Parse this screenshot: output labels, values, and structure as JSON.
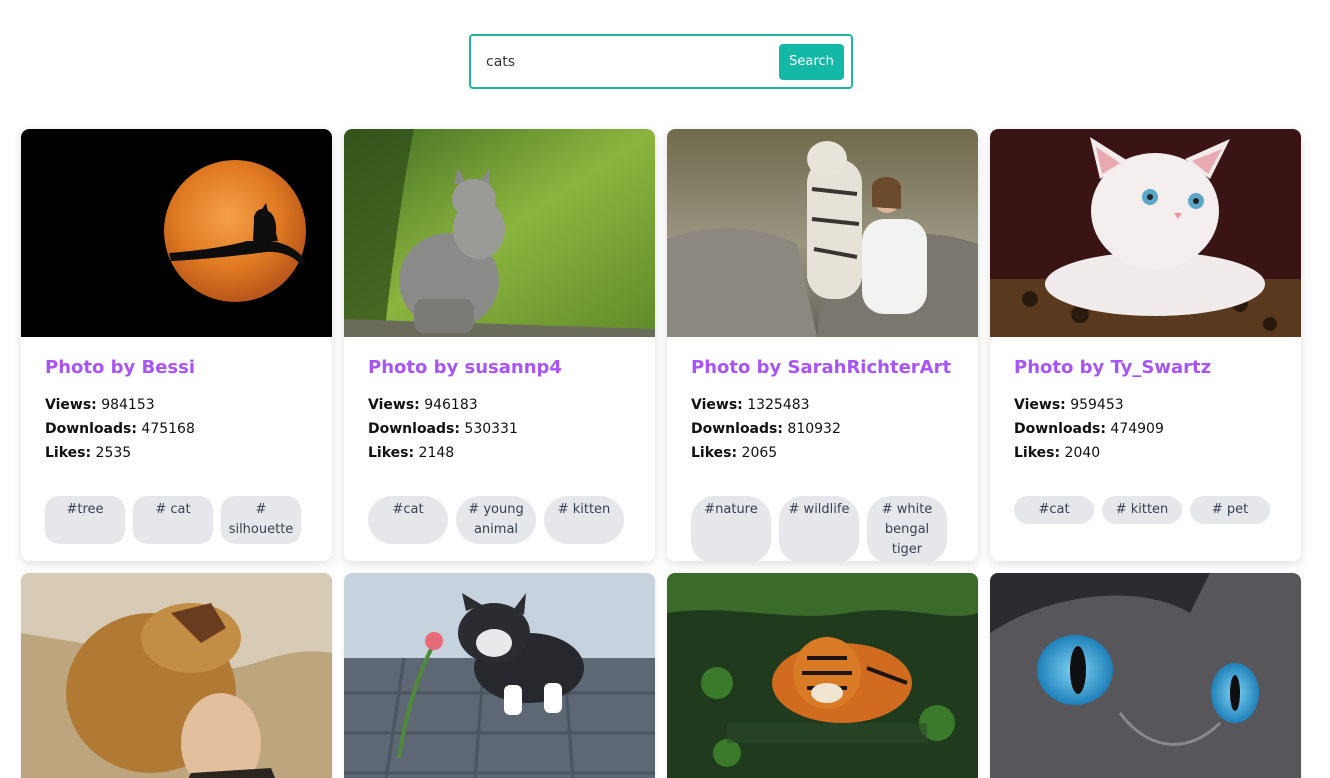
{
  "search": {
    "value": "cats",
    "button_label": "Search"
  },
  "cards": [
    {
      "title": "Photo by Bessi",
      "views_label": "Views:",
      "views": "984153",
      "downloads_label": "Downloads:",
      "downloads": "475168",
      "likes_label": "Likes:",
      "likes": "2535",
      "tags": [
        "#tree",
        "# cat",
        "# silhouette"
      ]
    },
    {
      "title": "Photo by susannp4",
      "views_label": "Views:",
      "views": "946183",
      "downloads_label": "Downloads:",
      "downloads": "530331",
      "likes_label": "Likes:",
      "likes": "2148",
      "tags": [
        "#cat",
        "# young animal",
        "# kitten"
      ]
    },
    {
      "title": "Photo by SarahRichterArt",
      "views_label": "Views:",
      "views": "1325483",
      "downloads_label": "Downloads:",
      "downloads": "810932",
      "likes_label": "Likes:",
      "likes": "2065",
      "tags": [
        "#nature",
        "# wildlife",
        "# white bengal tiger"
      ]
    },
    {
      "title": "Photo by Ty_Swartz",
      "views_label": "Views:",
      "views": "959453",
      "downloads_label": "Downloads:",
      "downloads": "474909",
      "likes_label": "Likes:",
      "likes": "2040",
      "tags": [
        "#cat",
        "# kitten",
        "# pet"
      ]
    }
  ],
  "colors": {
    "accent": "#14b8a6",
    "title": "#a855f7",
    "tag_bg": "#e5e7eb"
  }
}
